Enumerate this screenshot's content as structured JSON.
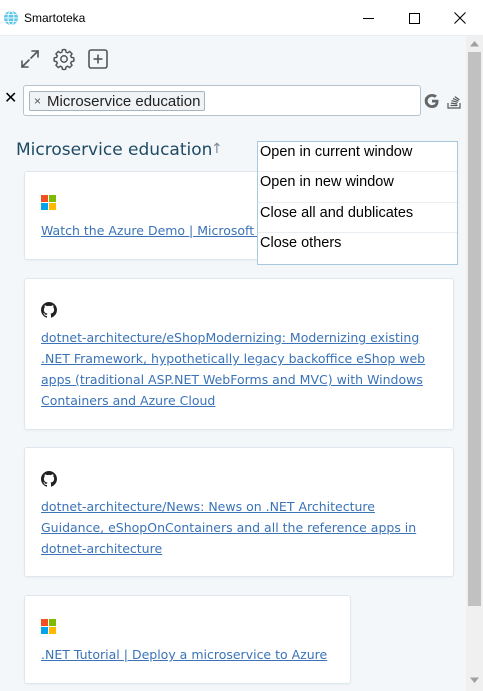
{
  "window": {
    "title": "Smartoteka",
    "icon": "globe-icon"
  },
  "toolbar": {
    "icons": [
      "expand-icon",
      "settings-icon",
      "add-icon"
    ]
  },
  "search": {
    "clear_label": "✕",
    "tags": [
      {
        "label": "Microservice education",
        "remove": "×"
      }
    ]
  },
  "section": {
    "title": "Microservice education",
    "sort_glyph": "↑"
  },
  "cards": [
    {
      "icon": "microsoft-icon",
      "link": "Watch the Azure Demo | Microsoft A"
    },
    {
      "icon": "github-icon",
      "link": "dotnet-architecture/eShopModernizing: Modernizing existing\n.NET Framework, hypothetically legacy backoffice eShop web\napps (traditional ASP.NET WebForms and MVC) with Windows\nContainers and Azure Cloud"
    },
    {
      "icon": "github-icon",
      "link": "dotnet-architecture/News: News on .NET Architecture\nGuidance, eShopOnContainers and all the reference apps in\ndotnet-architecture"
    },
    {
      "icon": "microsoft-icon",
      "link": ".NET Tutorial | Deploy a microservice to Azure"
    }
  ],
  "context_menu": {
    "items": [
      {
        "label": "Open in current window"
      },
      {
        "label": "Open in new window"
      },
      {
        "label": "Close all and dublicates"
      },
      {
        "label": "Close others"
      }
    ]
  },
  "colors": {
    "accent": "#3a73b8",
    "title": "#1f4a63",
    "ms_red": "#f25022",
    "ms_green": "#7fba00",
    "ms_blue": "#00a4ef",
    "ms_yellow": "#ffb900"
  }
}
